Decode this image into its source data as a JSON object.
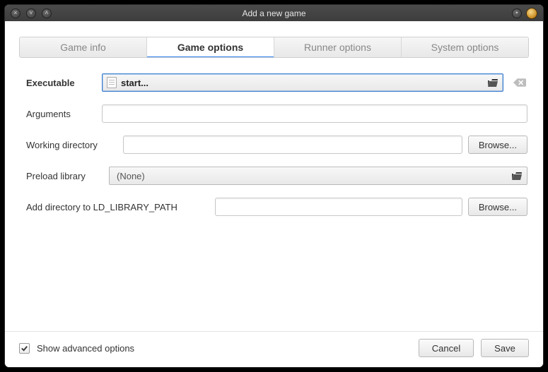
{
  "window": {
    "title": "Add a new game"
  },
  "tabs": {
    "game_info": "Game info",
    "game_options": "Game options",
    "runner_options": "Runner options",
    "system_options": "System options"
  },
  "form": {
    "executable": {
      "label": "Executable",
      "value": "start..."
    },
    "arguments": {
      "label": "Arguments",
      "value": ""
    },
    "workdir": {
      "label": "Working directory",
      "value": "",
      "browse": "Browse..."
    },
    "preload": {
      "label": "Preload library",
      "value": "(None)"
    },
    "ldpath": {
      "label": "Add directory to LD_LIBRARY_PATH",
      "value": "",
      "browse": "Browse..."
    }
  },
  "footer": {
    "show_advanced_label": "Show advanced options",
    "show_advanced_checked": true,
    "cancel": "Cancel",
    "save": "Save"
  }
}
